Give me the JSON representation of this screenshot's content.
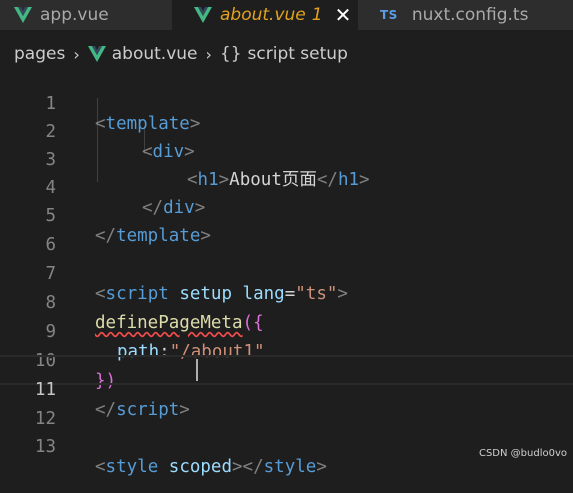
{
  "tabs": [
    {
      "label": "app.vue",
      "icon": "vue-icon",
      "state": "inactive"
    },
    {
      "label": "about.vue",
      "badge": "1",
      "icon": "vue-icon",
      "state": "active"
    },
    {
      "label": "nuxt.config.ts",
      "icon": "ts-icon",
      "icon_text": "TS",
      "state": "inactive"
    }
  ],
  "breadcrumb": {
    "folder": "pages",
    "file": "about.vue",
    "symbol_icon": "{}",
    "symbol": "script setup"
  },
  "editor": {
    "current_line": 11,
    "line_numbers": [
      "1",
      "2",
      "3",
      "4",
      "5",
      "6",
      "7",
      "8",
      "9",
      "10",
      "11",
      "12",
      "13"
    ],
    "code": {
      "l1": {
        "open": "<",
        "tag": "template",
        "close": ">"
      },
      "l2": {
        "open": "<",
        "tag": "div",
        "close": ">"
      },
      "l3": {
        "open": "<",
        "tag": "h1",
        "close": ">",
        "text": "About页面",
        "end_open": "</",
        "end_tag": "h1",
        "end_close": ">"
      },
      "l4": {
        "open": "</",
        "tag": "div",
        "close": ">"
      },
      "l5": {
        "open": "</",
        "tag": "template",
        "close": ">"
      },
      "l7": {
        "open": "<",
        "tag": "script",
        "attr1": "setup",
        "attr2": "lang",
        "eq": "=",
        "value": "\"ts\"",
        "close": ">"
      },
      "l8": {
        "fn": "definePageMeta",
        "paren": "(",
        "brace": "{"
      },
      "l9": {
        "prop": "path",
        "colon": ":",
        "value": "\"/about1\""
      },
      "l10": {
        "brace": "}",
        "paren": ")"
      },
      "l11": {
        "open": "</",
        "tag": "script",
        "close": ">"
      },
      "l13": {
        "open": "<",
        "tag": "style",
        "attr": "scoped",
        "close": ">",
        "end_open": "</",
        "end_tag": "style",
        "end_close": ">"
      }
    }
  },
  "watermark": "CSDN @budlo0vo",
  "colors": {
    "background": "#1e1e1e",
    "tag": "#569cd6",
    "attribute": "#9cdcfe",
    "string": "#ce9178",
    "function": "#dcdcaa",
    "active_tab_text": "#e2a21f",
    "vue_green": "#42b883"
  }
}
